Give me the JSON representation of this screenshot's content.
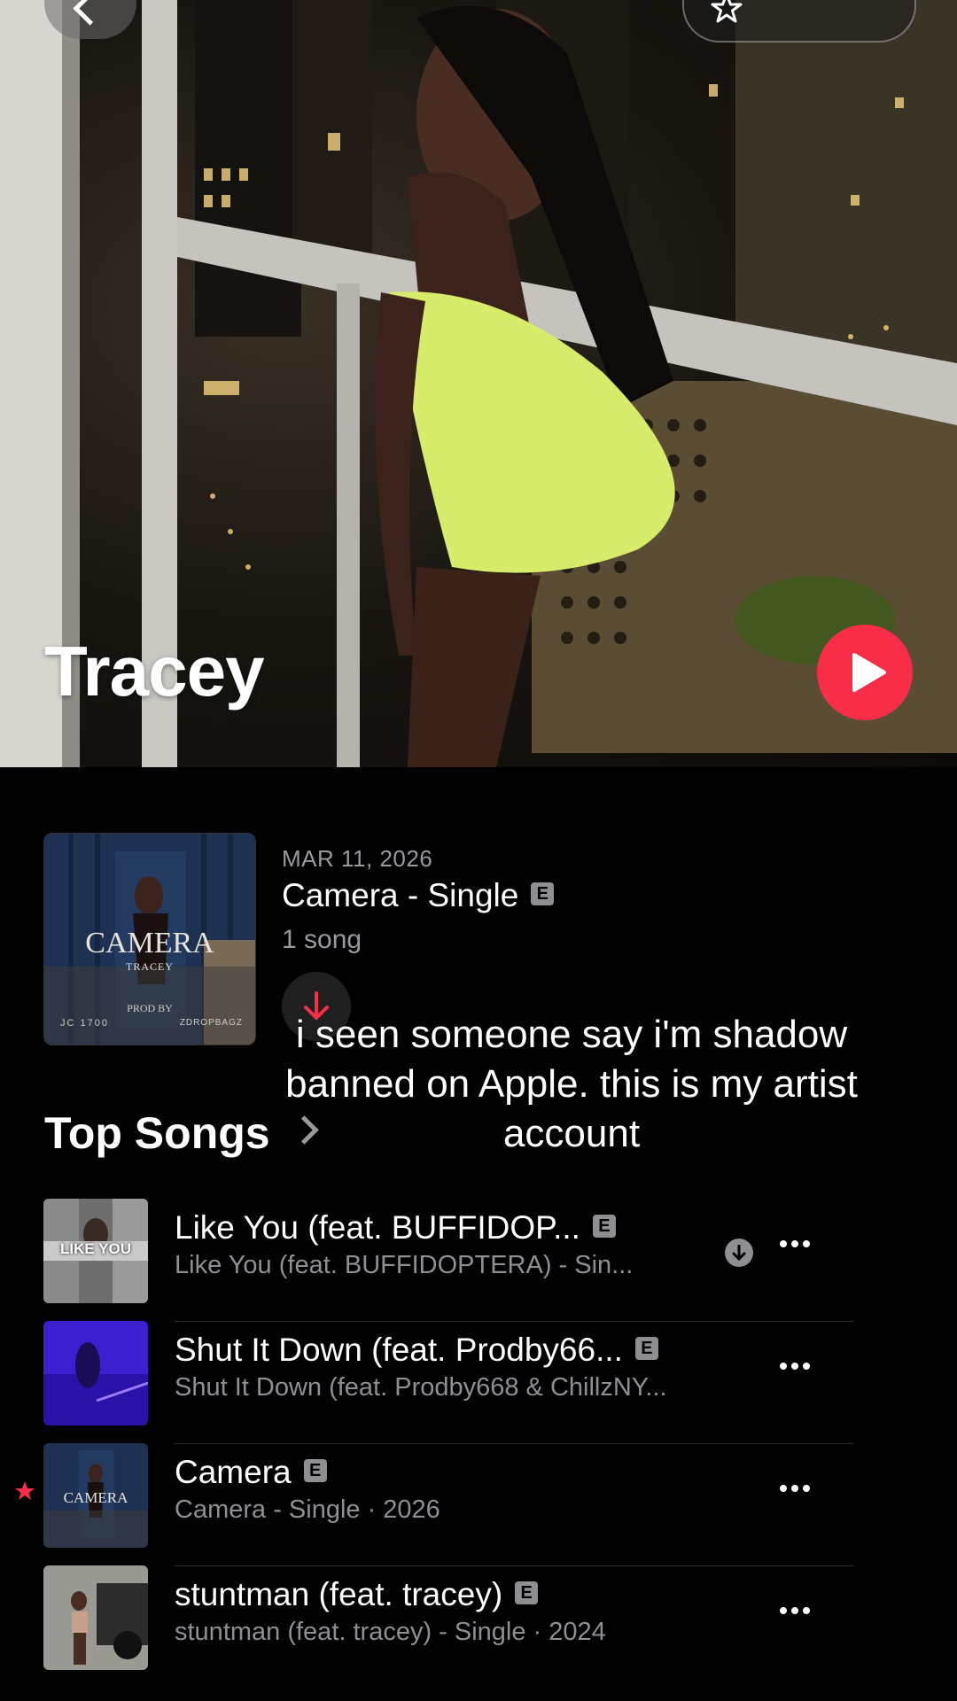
{
  "artist": {
    "name": "Tracey"
  },
  "colors": {
    "accent": "#fa2d48",
    "secondary_text": "#8e8e93"
  },
  "latest_release": {
    "date": "MAR 11, 2026",
    "title": "Camera - Single",
    "explicit": "E",
    "count": "1 song",
    "art": {
      "title": "CAMERA",
      "artist": "TRACEY",
      "prod": "PROD BY",
      "left": "JC 1700",
      "right": "ZDROPBAGZ"
    }
  },
  "caption": "i seen someone say i'm shadow banned on Apple. this is my artist account",
  "top_songs": {
    "title": "Top Songs",
    "items": [
      {
        "title": "Like You (feat. BUFFIDOP...",
        "subtitle": "Like You (feat. BUFFIDOPTERA) - Sin...",
        "explicit": "E",
        "art_label": "LIKE YOU"
      },
      {
        "title": "Shut It Down (feat. Prodby66...",
        "subtitle": "Shut It Down (feat. Prodby668 & ChillzNY...",
        "explicit": "E"
      },
      {
        "title": "Camera",
        "subtitle": "Camera - Single · 2026",
        "explicit": "E",
        "art_label": "CAMERA"
      },
      {
        "title": "stuntman (feat. tracey)",
        "subtitle": "stuntman (feat. tracey) - Single · 2024",
        "explicit": "E"
      }
    ]
  },
  "icons": {
    "back": "chevron-left-icon",
    "favorite": "star-icon",
    "play": "play-icon",
    "download": "arrow-down-icon",
    "more": "ellipsis-icon"
  }
}
